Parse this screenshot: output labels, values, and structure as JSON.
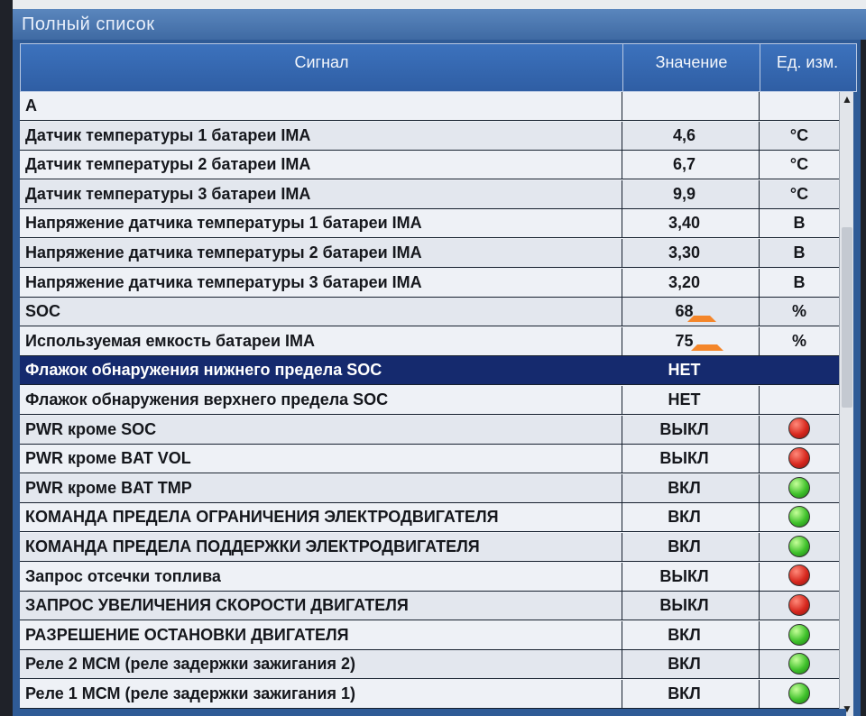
{
  "window": {
    "title": "Полный список"
  },
  "columns": {
    "signal": "Сигнал",
    "value": "Значение",
    "unit": "Ед. изм."
  },
  "rows": [
    {
      "signal": "А",
      "value": "",
      "unit": ""
    },
    {
      "signal": "Датчик температуры 1 батареи IMA",
      "value": "4,6",
      "unit": "°C"
    },
    {
      "signal": "Датчик температуры 2 батареи IMA",
      "value": "6,7",
      "unit": "°C"
    },
    {
      "signal": "Датчик температуры 3 батареи IMA",
      "value": "9,9",
      "unit": "°C"
    },
    {
      "signal": "Напряжение датчика температуры 1 батареи IMA",
      "value": "3,40",
      "unit": "В"
    },
    {
      "signal": "Напряжение датчика температуры 2 батареи IMA",
      "value": "3,30",
      "unit": "В"
    },
    {
      "signal": "Напряжение датчика температуры 3 батареи IMA",
      "value": "3,20",
      "unit": "В"
    },
    {
      "signal": "SOC",
      "value": "68",
      "unit": "%"
    },
    {
      "signal": "Используемая емкость батареи IMA",
      "value": "75",
      "unit": "%"
    },
    {
      "signal": "Флажок обнаружения нижнего предела SOC",
      "value": "НЕТ",
      "unit": ""
    },
    {
      "signal": "Флажок обнаружения верхнего предела SOC",
      "value": "НЕТ",
      "unit": ""
    },
    {
      "signal": "PWR кроме SOC",
      "value": "ВЫКЛ",
      "lamp": "red"
    },
    {
      "signal": "PWR кроме BAT VOL",
      "value": "ВЫКЛ",
      "lamp": "red"
    },
    {
      "signal": "PWR кроме BAT TMP",
      "value": "ВКЛ",
      "lamp": "green"
    },
    {
      "signal": "КОМАНДА ПРЕДЕЛА ОГРАНИЧЕНИЯ ЭЛЕКТРОДВИГАТЕЛЯ",
      "value": "ВКЛ",
      "lamp": "green"
    },
    {
      "signal": "КОМАНДА ПРЕДЕЛА ПОДДЕРЖКИ ЭЛЕКТРОДВИГАТЕЛЯ",
      "value": "ВКЛ",
      "lamp": "green"
    },
    {
      "signal": "Запрос отсечки топлива",
      "value": "ВЫКЛ",
      "lamp": "red"
    },
    {
      "signal": "ЗАПРОС УВЕЛИЧЕНИЯ СКОРОСТИ ДВИГАТЕЛЯ",
      "value": "ВЫКЛ",
      "lamp": "red"
    },
    {
      "signal": "РАЗРЕШЕНИЕ ОСТАНОВКИ ДВИГАТЕЛЯ",
      "value": "ВКЛ",
      "lamp": "green"
    },
    {
      "signal": "Реле 2 МСМ (реле задержки зажигания 2)",
      "value": "ВКЛ",
      "lamp": "green"
    },
    {
      "signal": "Реле 1 МСМ (реле задержки зажигания 1)",
      "value": "ВКЛ",
      "lamp": "green"
    }
  ],
  "selected_row": 9,
  "colors": {
    "selected": "#152a6e",
    "header": "#2f5ea4",
    "annotation": "#f4862a"
  }
}
